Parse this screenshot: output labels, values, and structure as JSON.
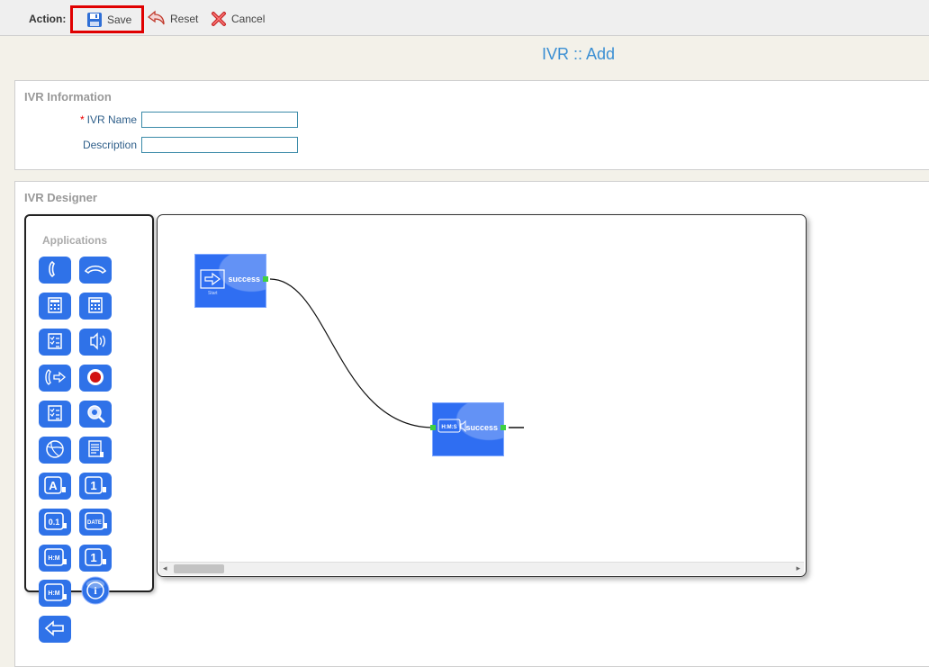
{
  "toolbar": {
    "action_label": "Action:",
    "save_label": "Save",
    "reset_label": "Reset",
    "cancel_label": "Cancel"
  },
  "page": {
    "title": "IVR :: Add"
  },
  "info": {
    "title": "IVR Information",
    "name_required": "*",
    "name_label": "IVR Name",
    "name_value": "",
    "description_label": "Description",
    "description_value": ""
  },
  "designer": {
    "title": "IVR Designer",
    "apps_title": "Applications",
    "nodes": [
      {
        "name": "start-node",
        "label": "success",
        "sublabel": "Start"
      },
      {
        "name": "say-time-node",
        "label": "success",
        "icon_text": "H:M:S"
      }
    ],
    "apps": [
      {
        "name": "answer-icon"
      },
      {
        "name": "hangup-icon"
      },
      {
        "name": "calculator-icon"
      },
      {
        "name": "calculator-alt-icon"
      },
      {
        "name": "checklist-icon"
      },
      {
        "name": "speaker-icon"
      },
      {
        "name": "transfer-call-icon"
      },
      {
        "name": "record-icon"
      },
      {
        "name": "checklist-alt-icon"
      },
      {
        "name": "search-icon"
      },
      {
        "name": "globe-icon"
      },
      {
        "name": "document-icon"
      },
      {
        "name": "say-alpha-icon",
        "text": "A"
      },
      {
        "name": "say-digit-icon",
        "text": "1"
      },
      {
        "name": "say-number-icon",
        "text": "0.1"
      },
      {
        "name": "say-date-icon",
        "text": "DATE"
      },
      {
        "name": "say-time-hm-icon",
        "text": "H:M"
      },
      {
        "name": "say-digit-alt-icon",
        "text": "1"
      },
      {
        "name": "say-time-hm-alt-icon",
        "text": "H:M"
      },
      {
        "name": "info-icon",
        "text": "i"
      },
      {
        "name": "back-arrow-icon"
      }
    ]
  },
  "colors": {
    "accent": "#3b8fd3",
    "node_blue": "#2f6ef2",
    "app_blue": "#2f72e8",
    "highlight": "#e00000",
    "connector": "#3fd13f"
  }
}
